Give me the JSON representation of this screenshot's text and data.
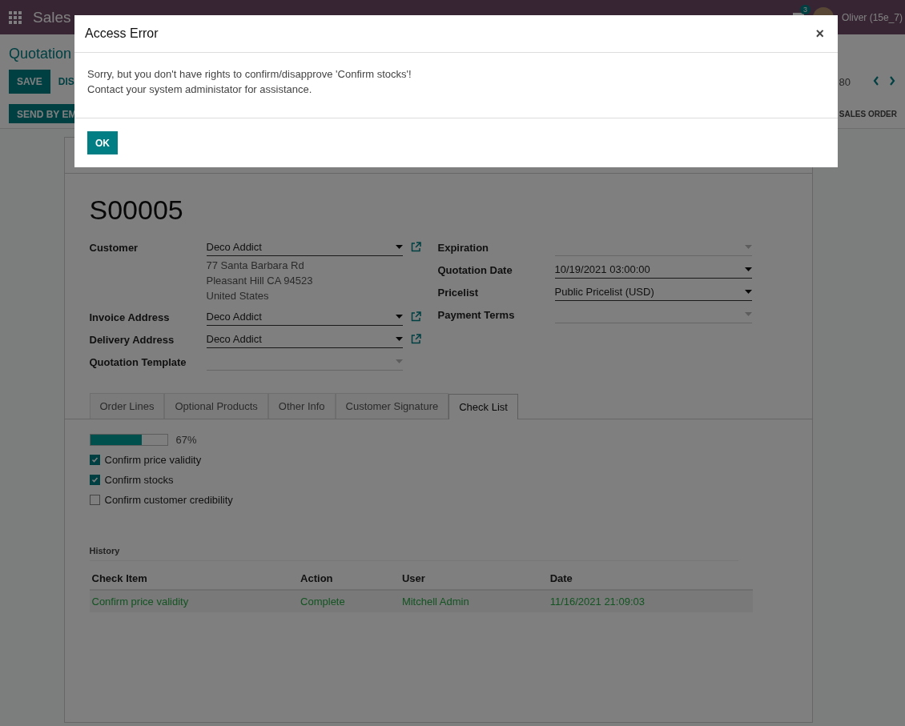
{
  "navbar": {
    "app": "Sales",
    "badge": "3",
    "user": "Oliver (15e_7)"
  },
  "control_panel": {
    "breadcrumb": "Quotation",
    "buttons": [
      "SAVE",
      "DIS"
    ],
    "pager": "80",
    "status_button": "SEND BY EM",
    "status_stage": "SALES ORDER"
  },
  "record": {
    "name": "S00005",
    "left_fields": [
      {
        "label": "Customer",
        "value": "Deco Addict",
        "address": [
          "77 Santa Barbara Rd",
          "Pleasant Hill CA 94523",
          "United States"
        ],
        "link": true
      },
      {
        "label": "Invoice Address",
        "value": "Deco Addict",
        "link": true
      },
      {
        "label": "Delivery Address",
        "value": "Deco Addict",
        "link": true
      },
      {
        "label": "Quotation Template",
        "link": false
      }
    ],
    "right_fields": [
      {
        "label": "Expiration"
      },
      {
        "label": "Quotation Date",
        "value": "10/19/2021 03:00:00"
      },
      {
        "label": "Pricelist",
        "value": "Public Pricelist (USD)"
      },
      {
        "label": "Payment Terms"
      }
    ]
  },
  "tabs": [
    {
      "label": "Order Lines",
      "selected": false
    },
    {
      "label": "Optional Products",
      "selected": false
    },
    {
      "label": "Other Info",
      "selected": false
    },
    {
      "label": "Customer Signature",
      "selected": false
    },
    {
      "label": "Check List",
      "selected": true
    }
  ],
  "checklist": {
    "level": 0.67,
    "reading": "67%",
    "items": [
      {
        "label": "Confirm price validity",
        "checked": true
      },
      {
        "label": "Confirm stocks",
        "checked": true
      },
      {
        "label": "Confirm customer credibility",
        "checked": false
      }
    ]
  },
  "history": {
    "title": "History",
    "columns": [
      "Check Item",
      "Action",
      "User",
      "Date"
    ],
    "rows": [
      [
        "Confirm price validity",
        "Complete",
        "Mitchell Admin",
        "11/16/2021 21:09:03"
      ]
    ]
  },
  "dialog": {
    "title": "Access Error",
    "close": "×",
    "lines": [
      "Sorry, but you don't have rights to confirm/disapprove 'Confirm stocks'!",
      "Contact your system administator for assistance."
    ],
    "button": "OK"
  }
}
